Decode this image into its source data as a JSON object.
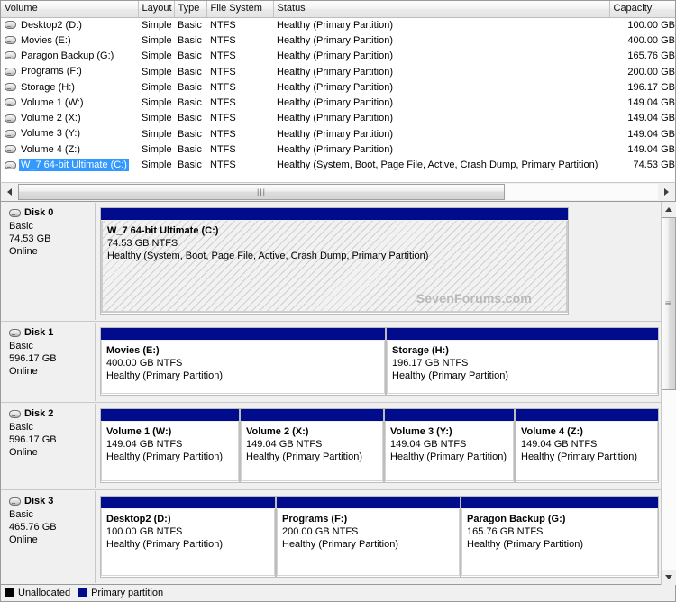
{
  "volume_list": {
    "columns": [
      "Volume",
      "Layout",
      "Type",
      "File System",
      "Status",
      "Capacity"
    ],
    "rows": [
      {
        "volume": "Desktop2 (D:)",
        "layout": "Simple",
        "type": "Basic",
        "fs": "NTFS",
        "status": "Healthy (Primary Partition)",
        "capacity": "100.00 GB",
        "selected": false
      },
      {
        "volume": "Movies (E:)",
        "layout": "Simple",
        "type": "Basic",
        "fs": "NTFS",
        "status": "Healthy (Primary Partition)",
        "capacity": "400.00 GB",
        "selected": false
      },
      {
        "volume": "Paragon Backup (G:)",
        "layout": "Simple",
        "type": "Basic",
        "fs": "NTFS",
        "status": "Healthy (Primary Partition)",
        "capacity": "165.76 GB",
        "selected": false
      },
      {
        "volume": "Programs (F:)",
        "layout": "Simple",
        "type": "Basic",
        "fs": "NTFS",
        "status": "Healthy (Primary Partition)",
        "capacity": "200.00 GB",
        "selected": false
      },
      {
        "volume": "Storage (H:)",
        "layout": "Simple",
        "type": "Basic",
        "fs": "NTFS",
        "status": "Healthy (Primary Partition)",
        "capacity": "196.17 GB",
        "selected": false
      },
      {
        "volume": "Volume 1 (W:)",
        "layout": "Simple",
        "type": "Basic",
        "fs": "NTFS",
        "status": "Healthy (Primary Partition)",
        "capacity": "149.04 GB",
        "selected": false
      },
      {
        "volume": "Volume 2 (X:)",
        "layout": "Simple",
        "type": "Basic",
        "fs": "NTFS",
        "status": "Healthy (Primary Partition)",
        "capacity": "149.04 GB",
        "selected": false
      },
      {
        "volume": "Volume 3 (Y:)",
        "layout": "Simple",
        "type": "Basic",
        "fs": "NTFS",
        "status": "Healthy (Primary Partition)",
        "capacity": "149.04 GB",
        "selected": false
      },
      {
        "volume": "Volume 4 (Z:)",
        "layout": "Simple",
        "type": "Basic",
        "fs": "NTFS",
        "status": "Healthy (Primary Partition)",
        "capacity": "149.04 GB",
        "selected": false
      },
      {
        "volume": "W_7 64-bit Ultimate (C:)",
        "layout": "Simple",
        "type": "Basic",
        "fs": "NTFS",
        "status": "Healthy (System, Boot, Page File, Active, Crash Dump, Primary Partition)",
        "capacity": "74.53 GB",
        "selected": true
      }
    ]
  },
  "graphical_view": {
    "disks": [
      {
        "name": "Disk 0",
        "kind": "Basic",
        "size": "74.53 GB",
        "state": "Online",
        "partitions": [
          {
            "name": "W_7 64-bit Ultimate  (C:)",
            "size": "74.53 GB NTFS",
            "status": "Healthy (System, Boot, Page File, Active, Crash Dump, Primary Partition)",
            "selected": true,
            "watermark": "SevenForums.com"
          }
        ]
      },
      {
        "name": "Disk 1",
        "kind": "Basic",
        "size": "596.17 GB",
        "state": "Online",
        "partitions": [
          {
            "name": "Movies  (E:)",
            "size": "400.00 GB NTFS",
            "status": "Healthy (Primary Partition)",
            "selected": false
          },
          {
            "name": "Storage  (H:)",
            "size": "196.17 GB NTFS",
            "status": "Healthy (Primary Partition)",
            "selected": false
          }
        ]
      },
      {
        "name": "Disk 2",
        "kind": "Basic",
        "size": "596.17 GB",
        "state": "Online",
        "partitions": [
          {
            "name": "Volume 1  (W:)",
            "size": "149.04 GB NTFS",
            "status": "Healthy (Primary Partition)",
            "selected": false
          },
          {
            "name": "Volume 2  (X:)",
            "size": "149.04 GB NTFS",
            "status": "Healthy (Primary Partition)",
            "selected": false
          },
          {
            "name": "Volume 3  (Y:)",
            "size": "149.04 GB NTFS",
            "status": "Healthy (Primary Partition)",
            "selected": false
          },
          {
            "name": "Volume 4  (Z:)",
            "size": "149.04 GB NTFS",
            "status": "Healthy (Primary Partition)",
            "selected": false
          }
        ]
      },
      {
        "name": "Disk 3",
        "kind": "Basic",
        "size": "465.76 GB",
        "state": "Online",
        "partitions": [
          {
            "name": "Desktop2  (D:)",
            "size": "100.00 GB NTFS",
            "status": "Healthy (Primary Partition)",
            "selected": false
          },
          {
            "name": "Programs  (F:)",
            "size": "200.00 GB NTFS",
            "status": "Healthy (Primary Partition)",
            "selected": false
          },
          {
            "name": "Paragon Backup  (G:)",
            "size": "165.76 GB NTFS",
            "status": "Healthy (Primary Partition)",
            "selected": false
          }
        ]
      }
    ]
  },
  "legend": {
    "items": [
      {
        "label": "Unallocated",
        "color": "#000000"
      },
      {
        "label": "Primary partition",
        "color": "#000c8c"
      }
    ]
  },
  "colors": {
    "primary_partition": "#000c8c",
    "unallocated": "#000000",
    "selection": "#3399ff"
  }
}
